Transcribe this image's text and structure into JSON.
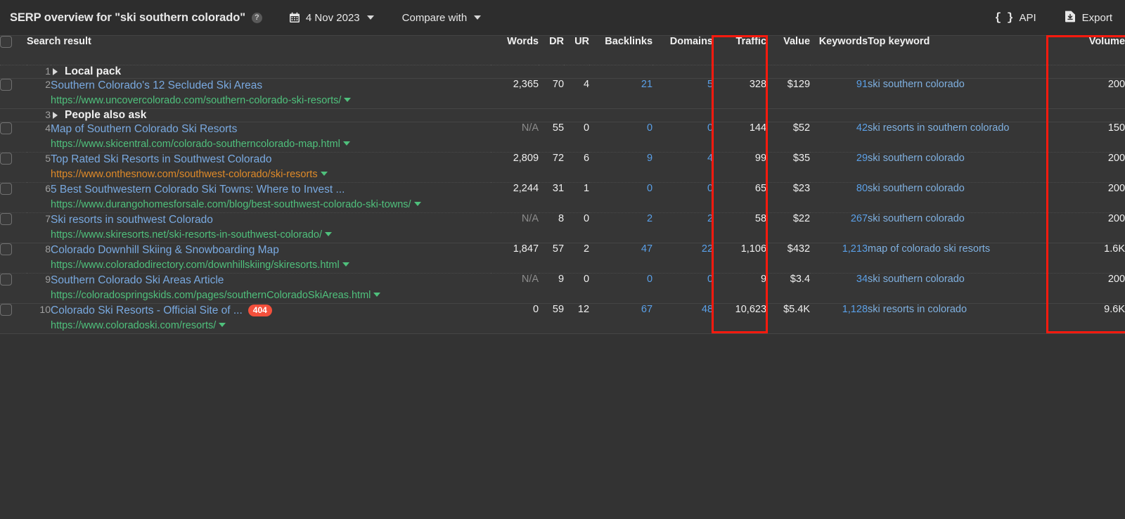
{
  "header": {
    "title": "SERP overview for \"ski southern colorado\"",
    "help_icon": "question-mark-icon",
    "date_value": "4 Nov 2023",
    "compare_label": "Compare with",
    "api_label": "API",
    "export_label": "Export"
  },
  "columns": {
    "search_result": "Search result",
    "words": "Words",
    "dr": "DR",
    "ur": "UR",
    "backlinks": "Backlinks",
    "domains": "Domains",
    "traffic": "Traffic",
    "value": "Value",
    "keywords": "Keywords",
    "top_keyword": "Top keyword",
    "volume": "Volume"
  },
  "highlights": {
    "color": "#fe1a0e",
    "columns": [
      "Traffic",
      "Volume"
    ]
  },
  "rows": [
    {
      "num": "1",
      "kind": "group",
      "label": "Local pack",
      "checkbox": false
    },
    {
      "num": "2",
      "kind": "result",
      "checkbox": true,
      "title": "Southern Colorado's 12 Secluded Ski Areas",
      "url": "https://www.uncovercolorado.com/southern-colorado-ski-resorts/",
      "url_color": "green",
      "badge": "",
      "words": "2,365",
      "dr": "70",
      "ur": "4",
      "backlinks": "21",
      "domains": "5",
      "traffic": "328",
      "value": "$129",
      "keywords": "91",
      "top_keyword": "ski southern colorado",
      "volume": "200"
    },
    {
      "num": "3",
      "kind": "group",
      "label": "People also ask",
      "checkbox": false
    },
    {
      "num": "4",
      "kind": "result",
      "checkbox": true,
      "title": "Map of Southern Colorado Ski Resorts",
      "url": "https://www.skicentral.com/colorado-southerncolorado-map.html",
      "url_color": "green",
      "badge": "",
      "words": "N/A",
      "dr": "55",
      "ur": "0",
      "backlinks": "0",
      "domains": "0",
      "traffic": "144",
      "value": "$52",
      "keywords": "42",
      "top_keyword": "ski resorts in southern colorado",
      "volume": "150"
    },
    {
      "num": "5",
      "kind": "result",
      "checkbox": true,
      "title": "Top Rated Ski Resorts in Southwest Colorado",
      "url": "https://www.onthesnow.com/southwest-colorado/ski-resorts",
      "url_color": "orange",
      "badge": "",
      "words": "2,809",
      "dr": "72",
      "ur": "6",
      "backlinks": "9",
      "domains": "4",
      "traffic": "99",
      "value": "$35",
      "keywords": "29",
      "top_keyword": "ski southern colorado",
      "volume": "200"
    },
    {
      "num": "6",
      "kind": "result",
      "checkbox": true,
      "title": "5 Best Southwestern Colorado Ski Towns: Where to Invest ...",
      "url": "https://www.durangohomesforsale.com/blog/best-southwest-colorado-ski-towns/",
      "url_color": "green",
      "badge": "",
      "words": "2,244",
      "dr": "31",
      "ur": "1",
      "backlinks": "0",
      "domains": "0",
      "traffic": "65",
      "value": "$23",
      "keywords": "80",
      "top_keyword": "ski southern colorado",
      "volume": "200"
    },
    {
      "num": "7",
      "kind": "result",
      "checkbox": true,
      "title": "Ski resorts in southwest Colorado",
      "url": "https://www.skiresorts.net/ski-resorts-in-southwest-colorado/",
      "url_color": "green",
      "badge": "",
      "words": "N/A",
      "dr": "8",
      "ur": "0",
      "backlinks": "2",
      "domains": "2",
      "traffic": "58",
      "value": "$22",
      "keywords": "267",
      "top_keyword": "ski southern colorado",
      "volume": "200"
    },
    {
      "num": "8",
      "kind": "result",
      "checkbox": true,
      "title": "Colorado Downhill Skiing & Snowboarding Map",
      "url": "https://www.coloradodirectory.com/downhillskiing/skiresorts.html",
      "url_color": "green",
      "badge": "",
      "words": "1,847",
      "dr": "57",
      "ur": "2",
      "backlinks": "47",
      "domains": "22",
      "traffic": "1,106",
      "value": "$432",
      "keywords": "1,213",
      "top_keyword": "map of colorado ski resorts",
      "volume": "1.6K"
    },
    {
      "num": "9",
      "kind": "result",
      "checkbox": true,
      "title": "Southern Colorado Ski Areas Article",
      "url": "https://coloradospringskids.com/pages/southernColoradoSkiAreas.html",
      "url_color": "green",
      "badge": "",
      "words": "N/A",
      "dr": "9",
      "ur": "0",
      "backlinks": "0",
      "domains": "0",
      "traffic": "9",
      "value": "$3.4",
      "keywords": "34",
      "top_keyword": "ski southern colorado",
      "volume": "200"
    },
    {
      "num": "10",
      "kind": "result",
      "checkbox": true,
      "title": "Colorado Ski Resorts - Official Site of ...",
      "url": "https://www.coloradoski.com/resorts/",
      "url_color": "green",
      "badge": "404",
      "words": "0",
      "dr": "59",
      "ur": "12",
      "backlinks": "67",
      "domains": "48",
      "traffic": "10,623",
      "value": "$5.4K",
      "keywords": "1,128",
      "top_keyword": "ski resorts in colorado",
      "volume": "9.6K"
    }
  ]
}
